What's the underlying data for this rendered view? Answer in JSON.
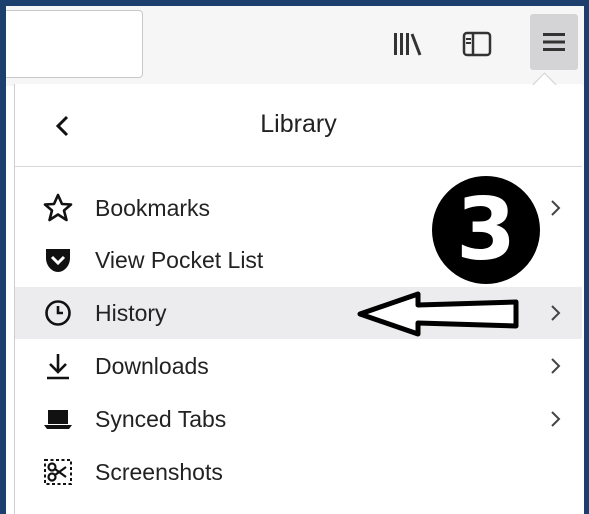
{
  "toolbar": {
    "icons": [
      "library-icon",
      "sidebar-icon",
      "hamburger-menu-icon"
    ]
  },
  "panel": {
    "title": "Library",
    "back_icon": "chevron-left-icon",
    "items": [
      {
        "label": "Bookmarks",
        "icon": "star-icon",
        "has_submenu": true
      },
      {
        "label": "View Pocket List",
        "icon": "pocket-icon",
        "has_submenu": false
      },
      {
        "label": "History",
        "icon": "clock-icon",
        "has_submenu": true,
        "highlighted": true
      },
      {
        "label": "Downloads",
        "icon": "download-icon",
        "has_submenu": true
      },
      {
        "label": "Synced Tabs",
        "icon": "laptop-icon",
        "has_submenu": true
      },
      {
        "label": "Screenshots",
        "icon": "scissors-icon",
        "has_submenu": false
      }
    ]
  },
  "annotation": {
    "step_number": "3",
    "arrow_target": "History",
    "colors": {
      "badge": "#000000",
      "arrow": "#000000"
    }
  }
}
